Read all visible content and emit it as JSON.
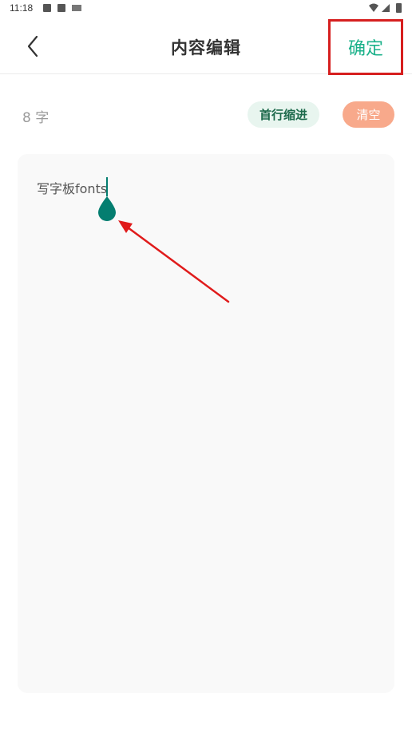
{
  "status_bar": {
    "time": "11:18"
  },
  "header": {
    "title": "内容编辑",
    "confirm_label": "确定"
  },
  "toolbar": {
    "char_count": "8 字",
    "indent_label": "首行缩进",
    "clear_label": "清空"
  },
  "editor": {
    "content": "写字板fonts"
  },
  "icons": {
    "back": "chevron-left-icon",
    "caret_handle": "text-cursor-handle-icon",
    "arrow": "annotation-arrow"
  },
  "colors": {
    "accent_green": "#1bb18a",
    "highlight_red": "#d61f1f",
    "caret_teal": "#047e70",
    "clear_orange": "#f8a98b",
    "indent_bg": "#e8f5ef"
  }
}
